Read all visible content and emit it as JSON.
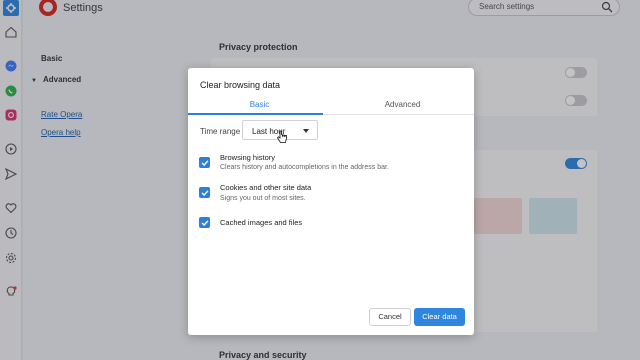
{
  "sidebar": {
    "icons": [
      "home-icon",
      "messenger-icon",
      "whatsapp-icon",
      "instagram-icon",
      "player-icon",
      "send-icon",
      "heart-icon",
      "history-icon",
      "settings-icon",
      "tips-icon"
    ]
  },
  "header": {
    "title": "Settings",
    "search_placeholder": "Search settings"
  },
  "nav": {
    "basic": "Basic",
    "advanced": "Advanced",
    "rate_link": "Rate Opera",
    "help_link": "Opera help"
  },
  "sections": {
    "privacy_protection": "Privacy protection",
    "privacy_security": "Privacy and security"
  },
  "dialog": {
    "title": "Clear browsing data",
    "tabs": [
      "Basic",
      "Advanced"
    ],
    "active_tab": "Basic",
    "time_range_label": "Time range",
    "time_range_value": "Last hour",
    "options": [
      {
        "title": "Browsing history",
        "subtitle": "Clears history and autocompletions in the address bar.",
        "checked": true
      },
      {
        "title": "Cookies and other site data",
        "subtitle": "Signs you out of most sites.",
        "checked": true
      },
      {
        "title": "Cached images and files",
        "subtitle": "",
        "checked": true
      }
    ],
    "cancel_label": "Cancel",
    "confirm_label": "Clear data"
  },
  "colors": {
    "accent": "#2e86de",
    "opera_red": "#d9231a",
    "sidebar_active": "#2e86de"
  }
}
